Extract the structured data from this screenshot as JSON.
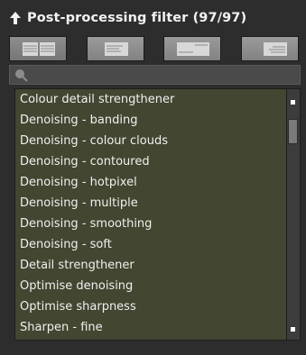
{
  "header": {
    "title": "Post-processing filter (97/97)",
    "collapse_icon": "arrow-up-icon"
  },
  "view_modes": [
    {
      "icon": "grid-list-view-icon"
    },
    {
      "icon": "compact-list-view-icon"
    },
    {
      "icon": "detail-view-icon"
    },
    {
      "icon": "right-aligned-view-icon"
    }
  ],
  "search": {
    "value": "",
    "placeholder": "",
    "icon": "search-icon"
  },
  "filters": [
    "Colour detail strengthener",
    "Denoising - banding",
    "Denoising - colour clouds",
    "Denoising - contoured",
    "Denoising - hotpixel",
    "Denoising - multiple",
    "Denoising - smoothing",
    "Denoising - soft",
    "Detail strengthener",
    "Optimise denoising",
    "Optimise sharpness",
    "Sharpen - fine"
  ],
  "colors": {
    "list_background": "#434630",
    "panel_background": "#2d2d2d"
  }
}
